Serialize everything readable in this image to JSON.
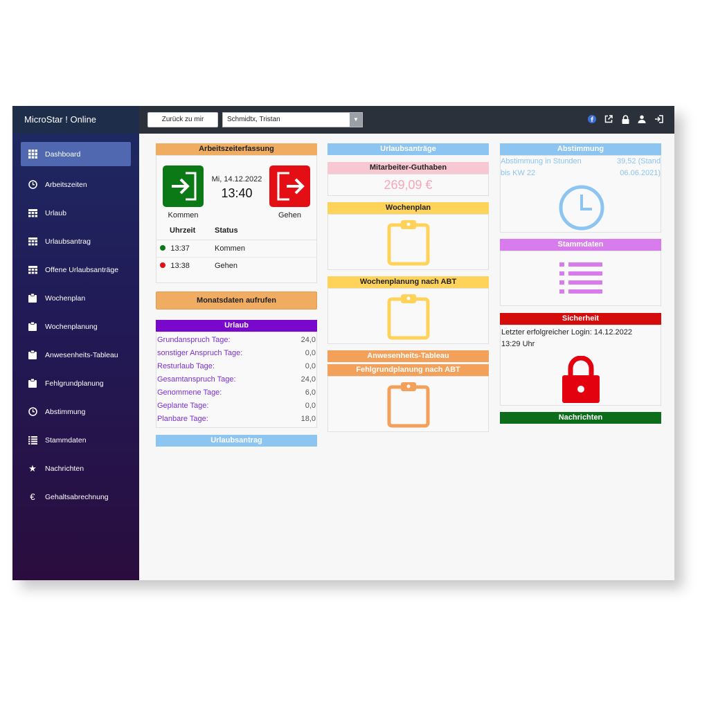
{
  "app": {
    "title": "MicroStar ! Online"
  },
  "sidebar": {
    "items": [
      {
        "label": "Dashboard",
        "icon": "grid-icon"
      },
      {
        "label": "Arbeitszeiten",
        "icon": "clock-icon"
      },
      {
        "label": "Urlaub",
        "icon": "calendar-icon"
      },
      {
        "label": "Urlaubsantrag",
        "icon": "calendar-icon"
      },
      {
        "label": "Offene Urlaubsanträge",
        "icon": "calendar-icon"
      },
      {
        "label": "Wochenplan",
        "icon": "clipboard-icon"
      },
      {
        "label": "Wochenplanung",
        "icon": "clipboard-icon"
      },
      {
        "label": "Anwesenheits-Tableau",
        "icon": "clipboard-icon"
      },
      {
        "label": "Fehlgrundplanung",
        "icon": "clipboard-icon"
      },
      {
        "label": "Abstimmung",
        "icon": "clock-icon"
      },
      {
        "label": "Stammdaten",
        "icon": "list-icon"
      },
      {
        "label": "Nachrichten",
        "icon": "star-icon"
      },
      {
        "label": "Gehaltsabrechnung",
        "icon": "euro-icon"
      }
    ]
  },
  "topbar": {
    "back_label": "Zurück zu mir",
    "user_selected": "Schmidtx, Tristan"
  },
  "arbeitszeit": {
    "title": "Arbeitszeiterfassung",
    "kommen_label": "Kommen",
    "gehen_label": "Gehen",
    "date": "Mi, 14.12.2022",
    "time": "13:40",
    "col_time": "Uhrzeit",
    "col_status": "Status",
    "rows": [
      {
        "time": "13:37",
        "status": "Kommen",
        "color": "#0b7a16"
      },
      {
        "time": "13:38",
        "status": "Gehen",
        "color": "#e30f14"
      }
    ],
    "monat_label": "Monatsdaten aufrufen"
  },
  "urlaub": {
    "title": "Urlaub",
    "rows": [
      {
        "label": "Grundanspruch Tage:",
        "value": "24,0"
      },
      {
        "label": "sonstiger Anspruch Tage:",
        "value": "0,0"
      },
      {
        "label": "Resturlaub Tage:",
        "value": "0,0"
      },
      {
        "label": "Gesamtanspruch Tage:",
        "value": "24,0"
      },
      {
        "label": "Genommene Tage:",
        "value": "6,0"
      },
      {
        "label": "Geplante Tage:",
        "value": "0,0"
      },
      {
        "label": "Planbare Tage:",
        "value": "18,0"
      }
    ],
    "antrag_title": "Urlaubsantrag"
  },
  "mid": {
    "urlaubsantraege": "Urlaubsanträge",
    "guthaben_title": "Mitarbeiter-Guthaben",
    "guthaben_value": "269,09 €",
    "wochenplan": "Wochenplan",
    "wochenplanung": "Wochenplanung nach ABT",
    "anwesenheit": "Anwesenheits-Tableau",
    "fehlgrund": "Fehlgrundplanung nach ABT"
  },
  "right": {
    "abstimmung_title": "Abstimmung",
    "abst_line1_left": "Abstimmung in Stunden",
    "abst_line1_right": "39,52 (Stand",
    "abst_line2_left": "bis KW 22",
    "abst_line2_right": "06.06.2021)",
    "stammdaten_title": "Stammdaten",
    "sicherheit_title": "Sicherheit",
    "sicherheit_line1": "Letzter erfolgreicher Login: 14.12.2022",
    "sicherheit_line2": "13:29 Uhr",
    "nachrichten_title": "Nachrichten"
  },
  "colors": {
    "orange": "#f0ad62",
    "purple": "#7a08cc",
    "lightblue": "#8cc4f2",
    "yellow": "#ffd35a",
    "magenta": "#d87ced",
    "red": "#d40c0c",
    "green": "#0c6e1a"
  }
}
